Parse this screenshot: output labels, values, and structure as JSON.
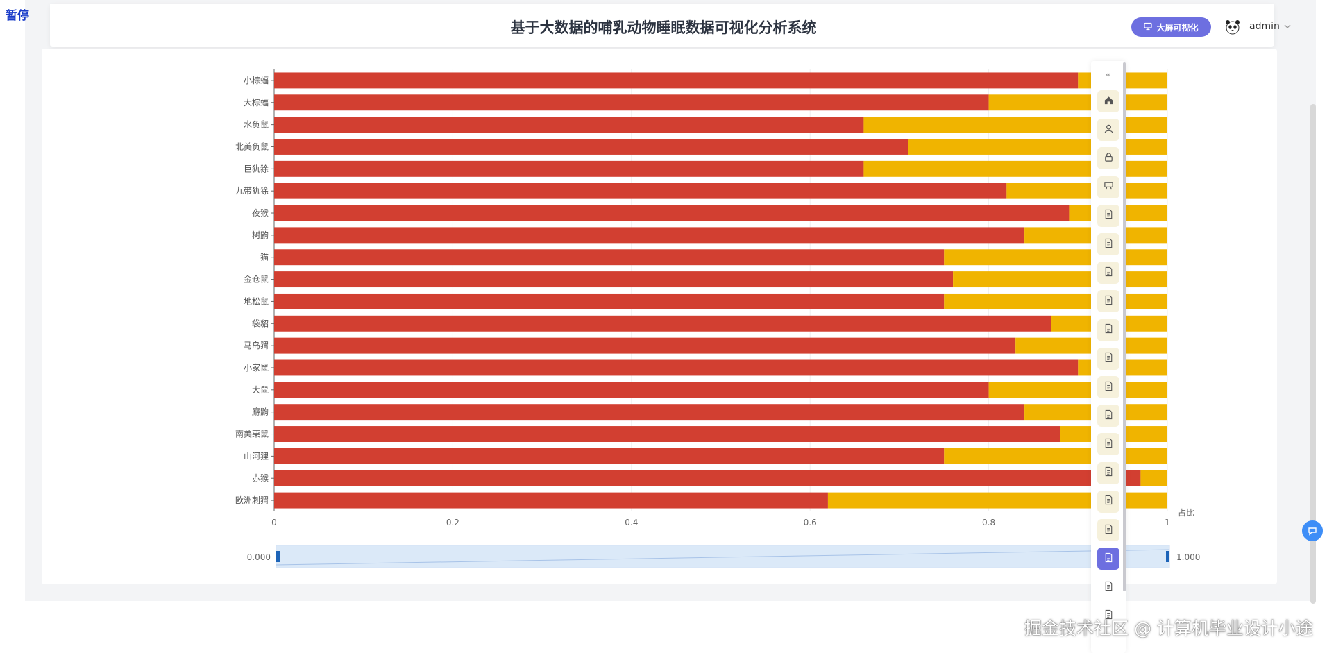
{
  "status": {
    "pause_label": "暂停"
  },
  "header": {
    "title": "基于大数据的哺乳动物睡眠数据可视化分析系统",
    "big_screen_label": "大屏可视化",
    "user_name": "admin",
    "icons": {
      "big_screen": "monitor-icon",
      "avatar": "panda-avatar",
      "caret": "chevron-down-icon"
    }
  },
  "side_menu": {
    "items": [
      {
        "icon": "home-icon",
        "active": false
      },
      {
        "icon": "user-icon",
        "active": false
      },
      {
        "icon": "lock-icon",
        "active": false
      },
      {
        "icon": "presentation-icon",
        "active": false
      },
      {
        "icon": "document-icon",
        "active": false
      },
      {
        "icon": "document-icon",
        "active": false
      },
      {
        "icon": "document-icon",
        "active": false
      },
      {
        "icon": "document-icon",
        "active": false
      },
      {
        "icon": "document-icon",
        "active": false
      },
      {
        "icon": "document-icon",
        "active": false
      },
      {
        "icon": "document-icon",
        "active": false
      },
      {
        "icon": "document-icon",
        "active": false
      },
      {
        "icon": "document-icon",
        "active": false
      },
      {
        "icon": "document-icon",
        "active": false
      },
      {
        "icon": "document-icon",
        "active": false
      },
      {
        "icon": "document-icon",
        "active": false
      },
      {
        "icon": "document-icon",
        "active": true
      },
      {
        "icon": "document-icon",
        "active": false
      },
      {
        "icon": "document-icon",
        "active": false
      }
    ]
  },
  "colors": {
    "series_a": "#d23f31",
    "series_b": "#f0b400",
    "accent": "#6d6fe0"
  },
  "chart_data": {
    "type": "bar",
    "orientation": "horizontal",
    "stacked": true,
    "categories": [
      "小棕蝠",
      "大棕蝠",
      "水负鼠",
      "北美负鼠",
      "巨犰狳",
      "九带犰狳",
      "夜猴",
      "树鼩",
      "猫",
      "金仓鼠",
      "地松鼠",
      "袋貂",
      "马岛猬",
      "小家鼠",
      "大鼠",
      "麝鼩",
      "南美栗鼠",
      "山河狸",
      "赤猴",
      "欧洲刺猬"
    ],
    "series": [
      {
        "values": [
          0.9,
          0.8,
          0.66,
          0.71,
          0.66,
          0.82,
          0.89,
          0.84,
          0.75,
          0.76,
          0.75,
          0.87,
          0.83,
          0.9,
          0.8,
          0.84,
          0.88,
          0.75,
          0.97,
          0.62
        ]
      },
      {
        "values": [
          0.1,
          0.2,
          0.34,
          0.29,
          0.34,
          0.18,
          0.11,
          0.16,
          0.25,
          0.24,
          0.25,
          0.13,
          0.17,
          0.1,
          0.2,
          0.16,
          0.12,
          0.25,
          0.03,
          0.38
        ]
      }
    ],
    "xlabel": "占比",
    "xticks": [
      "0",
      "0.2",
      "0.4",
      "0.6",
      "0.8",
      "1"
    ],
    "xlim": [
      0,
      1
    ],
    "grid": true,
    "data_zoom": {
      "start_label": "0.000",
      "end_label": "1.000",
      "start": 0,
      "end": 1
    }
  },
  "watermark": "掘金技术社区 @ 计算机毕业设计小途"
}
